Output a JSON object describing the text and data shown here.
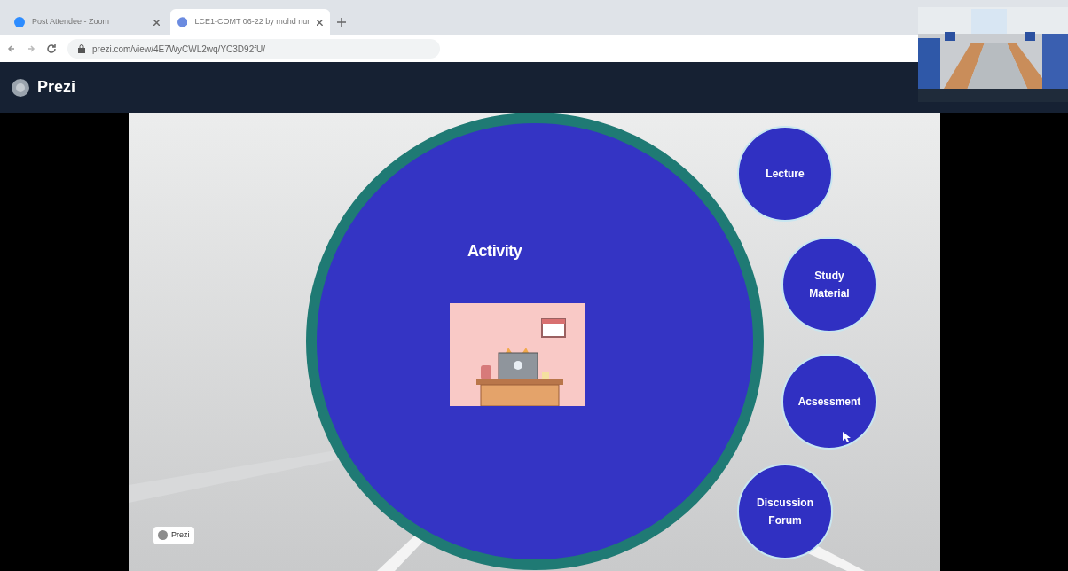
{
  "browser": {
    "tabs": [
      {
        "title": "Post Attendee - Zoom",
        "selected": false
      },
      {
        "title": "LCE1-COMT 06-22 by mohd nur",
        "selected": true
      }
    ],
    "address": "prezi.com/view/4E7WyCWL2wq/YC3D92fU/"
  },
  "app_bar": {
    "brand": "Prezi"
  },
  "slide": {
    "main_topic": {
      "title": "Activity"
    },
    "topics": [
      {
        "label": "Lecture"
      },
      {
        "label": "Study Material"
      },
      {
        "label": "Acsessment"
      },
      {
        "label": "Discussion Forum"
      }
    ],
    "watermark_badge": "Prezi"
  }
}
